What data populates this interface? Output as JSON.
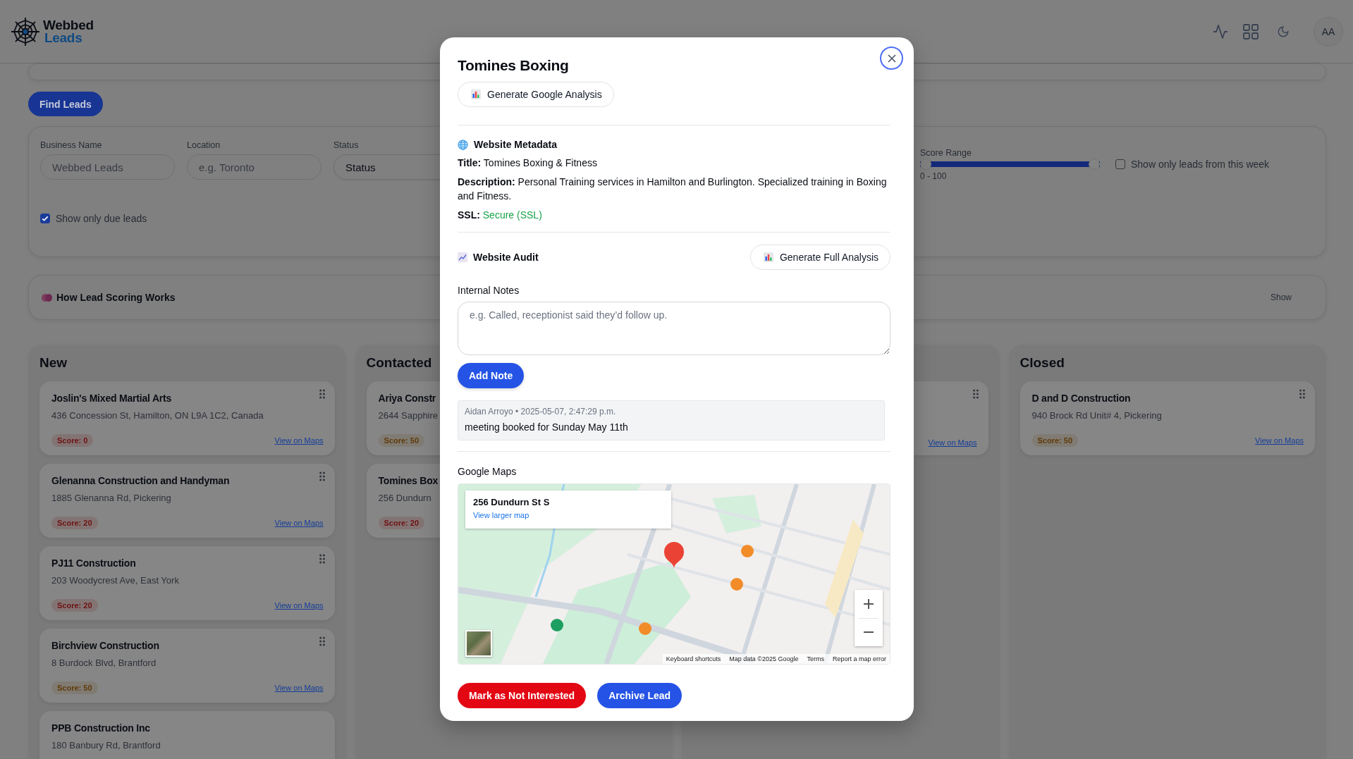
{
  "header": {
    "logo": {
      "line1": "Webbed",
      "line2": "Leads"
    },
    "avatar": "AA"
  },
  "find_button": "Find Leads",
  "filters": {
    "fields": [
      {
        "label": "Business Name",
        "placeholder": "Webbed Leads",
        "kind": "text"
      },
      {
        "label": "Location",
        "placeholder": "e.g. Toronto",
        "kind": "text"
      },
      {
        "label": "Status",
        "value": "Status",
        "kind": "select"
      }
    ],
    "score_range": {
      "label": "Score Range",
      "level": 1,
      "reading": "0 - 100"
    },
    "week_checkbox": {
      "label": "Show only leads from this week",
      "checked": false
    },
    "due_checkbox": {
      "label": "Show only due leads",
      "checked": true
    }
  },
  "scoring_panel": {
    "title": "How Lead Scoring Works",
    "toggle": "Show"
  },
  "columns": [
    {
      "title": "New",
      "cards": [
        {
          "name": "Joslin's Mixed Martial Arts",
          "address": "436 Concession St, Hamilton, ON L9A 1C2, Canada",
          "score": "Score: 0",
          "color": "#6e1212",
          "link": "View on Maps"
        },
        {
          "name": "Glenanna Construction and Handyman",
          "address": "1885 Glenanna Rd, Pickering",
          "score": "Score: 20",
          "color": "#6e1212",
          "link": "View on Maps"
        },
        {
          "name": "PJ11 Construction",
          "address": "203 Woodycrest Ave, East York",
          "score": "Score: 20",
          "color": "#6e1212",
          "link": "View on Maps"
        },
        {
          "name": "Birchview Construction",
          "address": "8 Burdock Blvd, Brantford",
          "score": "Score: 50",
          "color": "#5e3a08",
          "link": "View on Maps"
        },
        {
          "name": "PPB Construction Inc",
          "address": "180 Banbury Rd, Brantford"
        }
      ]
    },
    {
      "title": "Contacted",
      "cards": [
        {
          "name": "Ariya Constr",
          "address": "2644 Sapphire",
          "score": "Score: 50",
          "color": "#5e3a08"
        },
        {
          "name": "Tomines Box",
          "address": "256 Dundurn",
          "score": "Score: 20",
          "color": "#6e1212"
        }
      ]
    },
    {
      "cards": [
        {
          "link": "View on Maps"
        }
      ]
    },
    {
      "title": "Closed",
      "cards": [
        {
          "name": "D and D Construction",
          "address": "940 Brock Rd Unit# 4, Pickering",
          "score": "Score: 50",
          "color": "#5e3a08",
          "link": "View on Maps"
        }
      ]
    }
  ],
  "modal": {
    "title": "Tomines Boxing",
    "google_analysis_button": "Generate Google Analysis",
    "metadata": {
      "heading": "Website Metadata",
      "fields": [
        {
          "label": "Title:",
          "value": "Tomines Boxing & Fitness",
          "kind": "text"
        },
        {
          "label": "Description:",
          "value": "Personal Training services in Hamilton and Burlington. Specialized training in Boxing and Fitness.",
          "kind": "text"
        },
        {
          "label": "SSL:",
          "value": "Secure (SSL)",
          "kind": "ok"
        }
      ]
    },
    "audit": {
      "heading": "Website Audit",
      "button": "Generate Full Analysis"
    },
    "notes": {
      "label": "Internal Notes",
      "placeholder": "e.g. Called, receptionist said they’d follow up.",
      "add_button": "Add Note",
      "entries": [
        {
          "meta": "Aidan Arroyo • 2025-05-07, 2:47:29 p.m.",
          "text": "meeting booked for Sunday May 11th"
        }
      ]
    },
    "map": {
      "label": "Google Maps",
      "kind": "picture",
      "place_title": "256 Dundurn St S",
      "larger_map_link": "View larger map",
      "footer": [
        "Keyboard shortcuts",
        "Map data ©2025 Google",
        "Terms",
        "Report a map error"
      ]
    },
    "actions": [
      {
        "label": "Mark as Not Interested",
        "kind": "danger"
      },
      {
        "label": "Archive Lead",
        "kind": "primary"
      }
    ]
  }
}
